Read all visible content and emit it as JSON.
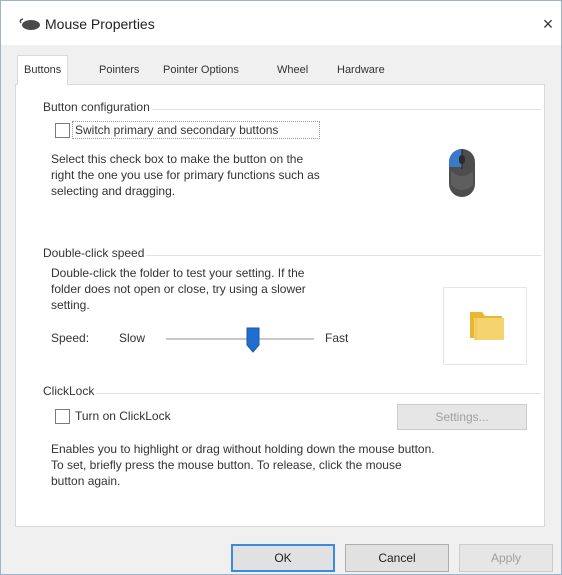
{
  "window": {
    "title": "Mouse Properties",
    "close_glyph": "×"
  },
  "tabs": [
    {
      "label": "Buttons",
      "active": true
    },
    {
      "label": "Pointers",
      "active": false
    },
    {
      "label": "Pointer Options",
      "active": false
    },
    {
      "label": "Wheel",
      "active": false
    },
    {
      "label": "Hardware",
      "active": false
    }
  ],
  "button_config": {
    "group_label": "Button configuration",
    "switch_label": "Switch primary and secondary buttons",
    "switch_checked": false,
    "description_lines": [
      "Select this check box to make the button on the",
      "right the one you use for primary functions such as",
      "selecting and dragging."
    ]
  },
  "double_click": {
    "group_label": "Double-click speed",
    "description_lines": [
      "Double-click the folder to test your setting. If the",
      "folder does not open or close, try using a slower",
      "setting."
    ],
    "speed_label": "Speed:",
    "slow_label": "Slow",
    "fast_label": "Fast",
    "speed_value": 0.55
  },
  "clicklock": {
    "group_label": "ClickLock",
    "checkbox_label": "Turn on ClickLock",
    "checked": false,
    "settings_label": "Settings...",
    "description_lines": [
      "Enables you to highlight or drag without holding down the mouse button.",
      "To set, briefly press the mouse button. To release, click the mouse",
      "button again."
    ]
  },
  "footer": {
    "ok_label": "OK",
    "cancel_label": "Cancel",
    "apply_label": "Apply"
  },
  "colors": {
    "accent": "#3c8ae0",
    "mouse_blue": "#3a78c9",
    "folder_yellow": "#f5c842"
  }
}
